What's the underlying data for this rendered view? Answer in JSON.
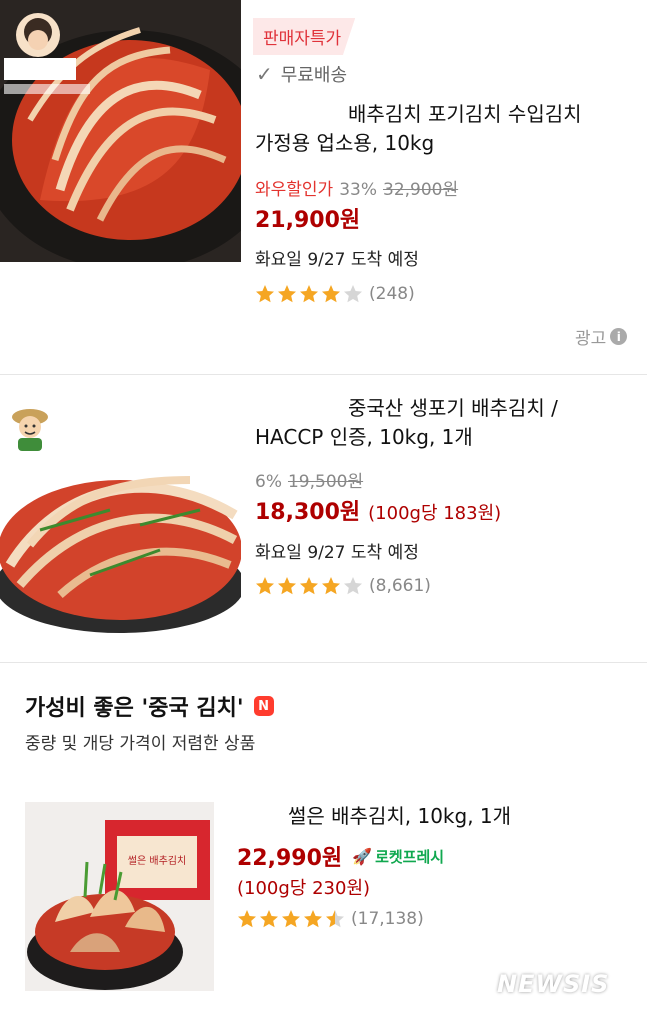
{
  "products": [
    {
      "badge": "판매자특가",
      "free_shipping": "무료배송",
      "title_line1": "배추김치 포기김치 수입김치",
      "title_line2": "가정용 업소용, 10kg",
      "sale_label": "와우할인가",
      "discount": "33%",
      "original_price": "32,900원",
      "price": "21,900원",
      "delivery": "화요일 9/27 도착 예정",
      "rating": 4,
      "review_count": "(248)",
      "ad_label": "광고"
    },
    {
      "title_line1": "중국산 생포기 배추김치 /",
      "title_line2": "HACCP 인증, 10kg, 1개",
      "discount": "6%",
      "original_price": "19,500원",
      "price": "18,300원",
      "unit_price": "(100g당 183원)",
      "delivery": "화요일 9/27 도착 예정",
      "rating": 4,
      "review_count": "(8,661)"
    }
  ],
  "section": {
    "title": "가성비 좋은 '중국 김치'",
    "badge": "N",
    "subtitle": "중량 및 개당 가격이 저렴한 상품"
  },
  "featured": {
    "title": "썰은 배추김치, 10kg, 1개",
    "price": "22,990원",
    "rocket_label": "로켓프레시",
    "unit_price": "(100g당 230원)",
    "rating": 4.5,
    "review_count": "(17,138)",
    "box_label": "썰은 배추김치"
  },
  "watermark": "NEWSIS",
  "colors": {
    "price_red": "#ae0000",
    "sale_red": "#e3342f",
    "star": "#f5a623",
    "rocket_green": "#10a84f"
  }
}
